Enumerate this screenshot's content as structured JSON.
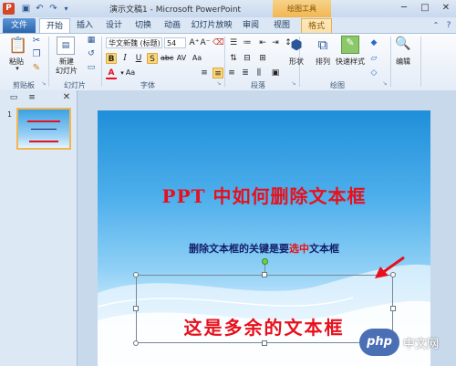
{
  "window": {
    "title": "演示文稿1 - Microsoft PowerPoint",
    "app_icon": "P",
    "context_tab_header": "绘图工具",
    "controls": [
      "minimize-icon",
      "maximize-icon",
      "close-icon"
    ]
  },
  "tabs": [
    {
      "label": "文件"
    },
    {
      "label": "开始"
    },
    {
      "label": "插入"
    },
    {
      "label": "设计"
    },
    {
      "label": "切换"
    },
    {
      "label": "动画"
    },
    {
      "label": "幻灯片放映"
    },
    {
      "label": "审阅"
    },
    {
      "label": "视图"
    },
    {
      "label": "格式"
    }
  ],
  "ribbon": {
    "clipboard": {
      "paste": "粘贴",
      "label": "剪贴板"
    },
    "slides": {
      "new_slide_line1": "新建",
      "new_slide_line2": "幻灯片",
      "label": "幻灯片"
    },
    "font": {
      "name": "华文新魏 (标题)",
      "size": "54",
      "label": "字体"
    },
    "paragraph": {
      "label": "段落"
    },
    "drawing": {
      "shape": "形状",
      "arrange": "排列",
      "quick_styles": "快速样式",
      "label": "绘图"
    },
    "editing": {
      "edit": "编辑"
    }
  },
  "thumbnail": {
    "number": "1"
  },
  "slide": {
    "title": "PPT 中如何删除文本框",
    "subtitle_pre": "删除文本框的关键是要",
    "subtitle_hl": "选中",
    "subtitle_post": "文本框",
    "extra_text": "这是多余的文本框"
  },
  "watermark": {
    "logo": "php",
    "text": "中文网"
  },
  "colors": {
    "title_red": "#e8101c",
    "subtitle_navy": "#14206a",
    "file_tab": "#2a64ad",
    "context_orange": "#f2b650"
  }
}
